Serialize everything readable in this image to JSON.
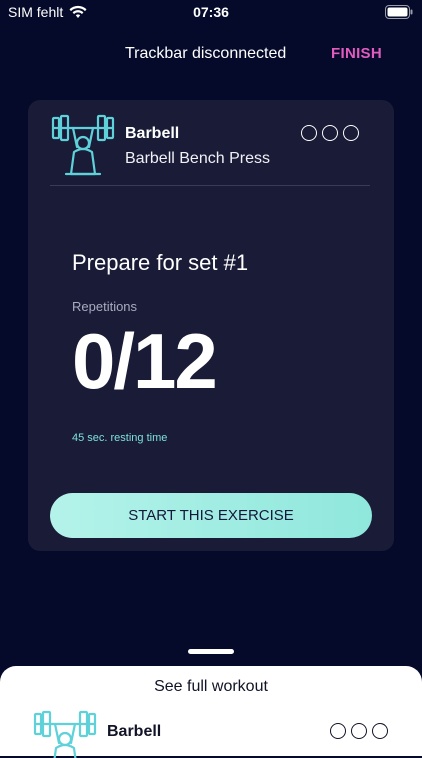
{
  "status_bar": {
    "carrier": "SIM fehlt",
    "time": "07:36"
  },
  "top_bar": {
    "connection_status": "Trackbar disconnected",
    "finish_label": "FINISH"
  },
  "exercise_card": {
    "equipment": "Barbell",
    "exercise": "Barbell Bench Press",
    "sets_total": 3,
    "prepare_title": "Prepare for set #1",
    "reps_label": "Repetitions",
    "reps_value": "0/12",
    "rest_time": "45 sec. resting time",
    "start_label": "START THIS EXERCISE"
  },
  "bottom_sheet": {
    "title": "See full workout",
    "equipment": "Barbell",
    "sets_total": 3
  },
  "colors": {
    "background": "#050a2a",
    "card": "#191b37",
    "accent_finish": "#e25cc0",
    "accent_teal": "#8fe7dc"
  }
}
